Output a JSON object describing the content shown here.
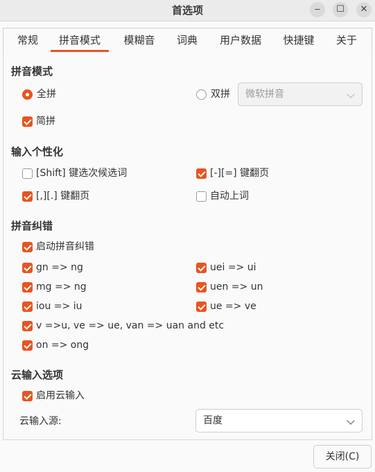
{
  "window": {
    "title": "首选项",
    "minimize": "‒",
    "maximize": "☐",
    "close": "✕"
  },
  "tabs": [
    "常规",
    "拼音模式",
    "模糊音",
    "词典",
    "用户数据",
    "快捷键",
    "关于"
  ],
  "active_tab": "拼音模式",
  "pinyin_mode": {
    "section": "拼音模式",
    "full": {
      "label": "全拼",
      "selected": true
    },
    "double": {
      "label": "双拼",
      "selected": false
    },
    "scheme": "微软拼音",
    "jianpin": {
      "label": "简拼",
      "checked": true
    }
  },
  "personalize": {
    "section": "输入个性化",
    "shift_select": {
      "label": "[Shift] 键选次候选词",
      "checked": false
    },
    "minus_equal_page": {
      "label": "[-][=] 键翻页",
      "checked": true
    },
    "comma_period_page": {
      "label": "[,][.] 键翻页",
      "checked": true
    },
    "auto_commit": {
      "label": "自动上词",
      "checked": false
    }
  },
  "correction": {
    "section": "拼音纠错",
    "enable": {
      "label": "启动拼音纠错",
      "checked": true
    },
    "gn": {
      "label": "gn => ng",
      "checked": true
    },
    "uei": {
      "label": "uei => ui",
      "checked": true
    },
    "mg": {
      "label": "mg => ng",
      "checked": true
    },
    "uen": {
      "label": "uen => un",
      "checked": true
    },
    "iou": {
      "label": "iou => iu",
      "checked": true
    },
    "ue": {
      "label": "ue => ve",
      "checked": true
    },
    "v": {
      "label": "v =>u, ve => ue, van => uan and etc",
      "checked": true
    },
    "on": {
      "label": "on => ong",
      "checked": true
    }
  },
  "cloud": {
    "section": "云输入选项",
    "enable": {
      "label": "启用云输入",
      "checked": true
    },
    "source_label": "云输入源:",
    "source_value": "百度"
  },
  "close_button": "关闭(C)",
  "accent_color": "#e95420"
}
